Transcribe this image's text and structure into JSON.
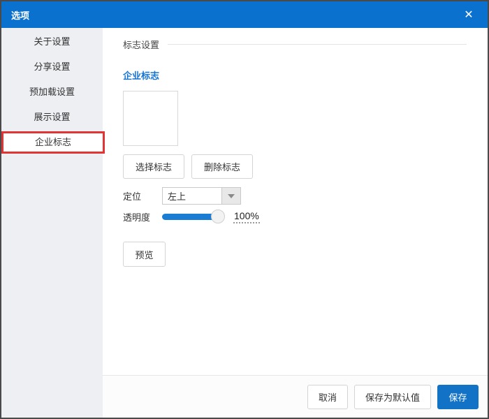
{
  "window": {
    "title": "选项",
    "close_icon": "✕"
  },
  "sidebar": {
    "items": [
      {
        "label": "关于设置"
      },
      {
        "label": "分享设置"
      },
      {
        "label": "预加载设置"
      },
      {
        "label": "展示设置"
      },
      {
        "label": "企业标志"
      }
    ],
    "selected_item": "企业标志"
  },
  "content": {
    "section_title": "标志设置",
    "subsection_title": "企业标志",
    "select_logo_button": "选择标志",
    "delete_logo_button": "删除标志",
    "position_label": "定位",
    "position_value": "左上",
    "opacity_label": "透明度",
    "opacity_value": "100%",
    "preview_button": "预览"
  },
  "footer": {
    "cancel_button": "取消",
    "save_default_button": "保存为默认值",
    "save_button": "保存"
  },
  "colors": {
    "titlebar_blue": "#0b71cf",
    "accent_blue": "#1573d1",
    "slider_blue": "#1b7cd3",
    "save_button_blue": "#1272c6",
    "highlight_red": "#e23434",
    "sidebar_gray": "#edeff2"
  }
}
